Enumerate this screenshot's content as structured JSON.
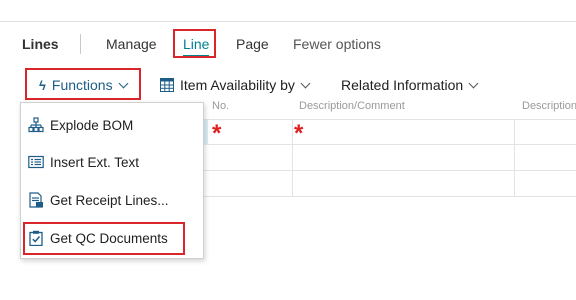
{
  "tabs": {
    "group_label": "Lines",
    "items": [
      "Manage",
      "Line",
      "Page",
      "Fewer options"
    ]
  },
  "actions": {
    "functions_label": "Functions",
    "item_availability_label": "Item Availability by",
    "related_info_label": "Related Information"
  },
  "table": {
    "headers": [
      "No.",
      "Description/Comment",
      "Description"
    ],
    "required_marker": "*"
  },
  "menu": {
    "items": [
      {
        "label": "Explode BOM",
        "icon": "explode-bom-icon"
      },
      {
        "label": "Insert Ext. Text",
        "icon": "insert-text-icon"
      },
      {
        "label": "Get Receipt Lines...",
        "icon": "receipt-lines-icon"
      },
      {
        "label": "Get QC Documents",
        "icon": "qc-documents-icon"
      }
    ]
  },
  "colors": {
    "accent": "#00838f",
    "highlight_box": "#d9262b",
    "link_blue": "#1e5d88",
    "required_star": "#e02020"
  }
}
